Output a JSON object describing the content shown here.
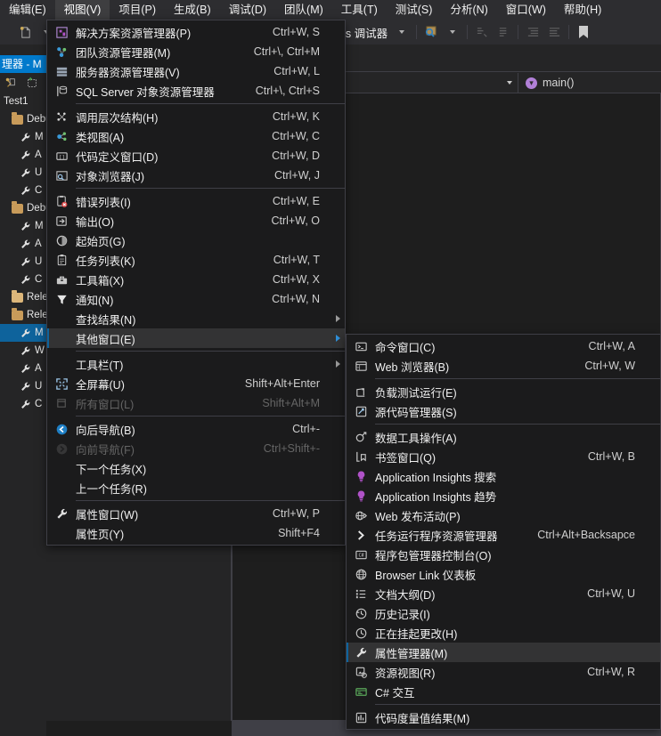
{
  "app": {
    "title": "Visual Studio",
    "accent": "#007acc",
    "menu_bg": "#1b1b1c",
    "highlight": "#333334"
  },
  "menubar": {
    "items": [
      {
        "label": "编辑(E)",
        "active": false
      },
      {
        "label": "视图(V)",
        "active": true
      },
      {
        "label": "项目(P)",
        "active": false
      },
      {
        "label": "生成(B)",
        "active": false
      },
      {
        "label": "调试(D)",
        "active": false
      },
      {
        "label": "团队(M)",
        "active": false
      },
      {
        "label": "工具(T)",
        "active": false
      },
      {
        "label": "测试(S)",
        "active": false
      },
      {
        "label": "分析(N)",
        "active": false
      },
      {
        "label": "窗口(W)",
        "active": false
      },
      {
        "label": "帮助(H)",
        "active": false
      }
    ]
  },
  "toolbar": {
    "run_label": "本地 Windows 调试器",
    "run_icon": "play-icon",
    "icons": [
      "new-item-icon",
      "find-icon",
      "comment-icon",
      "uncomment-icon",
      "indent-icon",
      "outdent-icon",
      "bookmark-icon"
    ]
  },
  "solution_explorer": {
    "title": "理器 - M",
    "full_title": "解决方案资源管理器 - Main",
    "toolbar_icons": [
      "refresh-icon",
      "show-all-files-icon"
    ],
    "tree": [
      {
        "label": "Test1",
        "icon": "project-icon",
        "depth": 0,
        "selected": false
      },
      {
        "label": "Debu",
        "icon": "folder-open-icon",
        "depth": 1,
        "selected": false
      },
      {
        "label": "M",
        "icon": "wrench-icon",
        "depth": 2,
        "selected": false
      },
      {
        "label": "A",
        "icon": "wrench-icon",
        "depth": 2,
        "selected": false
      },
      {
        "label": "U",
        "icon": "wrench-icon",
        "depth": 2,
        "selected": false
      },
      {
        "label": "C",
        "icon": "wrench-icon",
        "depth": 2,
        "selected": false
      },
      {
        "label": "Debu",
        "icon": "folder-open-icon",
        "depth": 1,
        "selected": false
      },
      {
        "label": "M",
        "icon": "wrench-icon",
        "depth": 2,
        "selected": false
      },
      {
        "label": "A",
        "icon": "wrench-icon",
        "depth": 2,
        "selected": false
      },
      {
        "label": "U",
        "icon": "wrench-icon",
        "depth": 2,
        "selected": false
      },
      {
        "label": "C",
        "icon": "wrench-icon",
        "depth": 2,
        "selected": false
      },
      {
        "label": "Relea",
        "icon": "folder-icon",
        "depth": 1,
        "selected": false
      },
      {
        "label": "Relea",
        "icon": "folder-open-icon",
        "depth": 1,
        "selected": false
      },
      {
        "label": "M",
        "icon": "wrench-icon",
        "depth": 2,
        "selected": true
      },
      {
        "label": "W",
        "icon": "wrench-icon",
        "depth": 2,
        "selected": false
      },
      {
        "label": "A",
        "icon": "wrench-icon",
        "depth": 2,
        "selected": false
      },
      {
        "label": "U",
        "icon": "wrench-icon",
        "depth": 2,
        "selected": false
      },
      {
        "label": "C",
        "icon": "wrench-icon",
        "depth": 2,
        "selected": false
      }
    ]
  },
  "navbar": {
    "member": "main()",
    "member_icon": "method-icon"
  },
  "view_menu": {
    "items": [
      {
        "type": "item",
        "icon": "solution-explorer-icon",
        "label": "解决方案资源管理器(P)",
        "shortcut": "Ctrl+W, S",
        "disabled": false,
        "submenu": false,
        "highlight": false
      },
      {
        "type": "item",
        "icon": "team-explorer-icon",
        "label": "团队资源管理器(M)",
        "shortcut": "Ctrl+\\, Ctrl+M",
        "disabled": false,
        "submenu": false,
        "highlight": false
      },
      {
        "type": "item",
        "icon": "server-explorer-icon",
        "label": "服务器资源管理器(V)",
        "shortcut": "Ctrl+W, L",
        "disabled": false,
        "submenu": false,
        "highlight": false
      },
      {
        "type": "item",
        "icon": "sql-object-explorer-icon",
        "label": "SQL Server 对象资源管理器",
        "shortcut": "Ctrl+\\, Ctrl+S",
        "disabled": false,
        "submenu": false,
        "highlight": false
      },
      {
        "type": "sep"
      },
      {
        "type": "item",
        "icon": "call-hierarchy-icon",
        "label": "调用层次结构(H)",
        "shortcut": "Ctrl+W, K",
        "disabled": false,
        "submenu": false,
        "highlight": false
      },
      {
        "type": "item",
        "icon": "class-view-icon",
        "label": "类视图(A)",
        "shortcut": "Ctrl+W, C",
        "disabled": false,
        "submenu": false,
        "highlight": false
      },
      {
        "type": "item",
        "icon": "code-definition-icon",
        "label": "代码定义窗口(D)",
        "shortcut": "Ctrl+W, D",
        "disabled": false,
        "submenu": false,
        "highlight": false
      },
      {
        "type": "item",
        "icon": "object-browser-icon",
        "label": "对象浏览器(J)",
        "shortcut": "Ctrl+W, J",
        "disabled": false,
        "submenu": false,
        "highlight": false
      },
      {
        "type": "sep"
      },
      {
        "type": "item",
        "icon": "error-list-icon",
        "label": "错误列表(I)",
        "shortcut": "Ctrl+W, E",
        "disabled": false,
        "submenu": false,
        "highlight": false
      },
      {
        "type": "item",
        "icon": "output-icon",
        "label": "输出(O)",
        "shortcut": "Ctrl+W, O",
        "disabled": false,
        "submenu": false,
        "highlight": false
      },
      {
        "type": "item",
        "icon": "start-page-icon",
        "label": "起始页(G)",
        "shortcut": "",
        "disabled": false,
        "submenu": false,
        "highlight": false
      },
      {
        "type": "item",
        "icon": "task-list-icon",
        "label": "任务列表(K)",
        "shortcut": "Ctrl+W, T",
        "disabled": false,
        "submenu": false,
        "highlight": false
      },
      {
        "type": "item",
        "icon": "toolbox-icon",
        "label": "工具箱(X)",
        "shortcut": "Ctrl+W, X",
        "disabled": false,
        "submenu": false,
        "highlight": false
      },
      {
        "type": "item",
        "icon": "notification-icon",
        "label": "通知(N)",
        "shortcut": "Ctrl+W, N",
        "disabled": false,
        "submenu": false,
        "highlight": false
      },
      {
        "type": "item",
        "icon": "",
        "label": "查找结果(N)",
        "shortcut": "",
        "disabled": false,
        "submenu": true,
        "highlight": false
      },
      {
        "type": "item",
        "icon": "",
        "label": "其他窗口(E)",
        "shortcut": "",
        "disabled": false,
        "submenu": true,
        "highlight": true
      },
      {
        "type": "sep"
      },
      {
        "type": "item",
        "icon": "",
        "label": "工具栏(T)",
        "shortcut": "",
        "disabled": false,
        "submenu": true,
        "highlight": false
      },
      {
        "type": "item",
        "icon": "fullscreen-icon",
        "label": "全屏幕(U)",
        "shortcut": "Shift+Alt+Enter",
        "disabled": false,
        "submenu": false,
        "highlight": false
      },
      {
        "type": "item",
        "icon": "all-windows-icon",
        "label": "所有窗口(L)",
        "shortcut": "Shift+Alt+M",
        "disabled": true,
        "submenu": false,
        "highlight": false
      },
      {
        "type": "sep"
      },
      {
        "type": "item",
        "icon": "navigate-backward-icon",
        "label": "向后导航(B)",
        "shortcut": "Ctrl+-",
        "disabled": false,
        "submenu": false,
        "highlight": false
      },
      {
        "type": "item",
        "icon": "navigate-forward-icon",
        "label": "向前导航(F)",
        "shortcut": "Ctrl+Shift+-",
        "disabled": true,
        "submenu": false,
        "highlight": false
      },
      {
        "type": "item",
        "icon": "",
        "label": "下一个任务(X)",
        "shortcut": "",
        "disabled": false,
        "submenu": false,
        "highlight": false
      },
      {
        "type": "item",
        "icon": "",
        "label": "上一个任务(R)",
        "shortcut": "",
        "disabled": false,
        "submenu": false,
        "highlight": false
      },
      {
        "type": "sep"
      },
      {
        "type": "item",
        "icon": "wrench-icon",
        "label": "属性窗口(W)",
        "shortcut": "Ctrl+W, P",
        "disabled": false,
        "submenu": false,
        "highlight": false
      },
      {
        "type": "item",
        "icon": "",
        "label": "属性页(Y)",
        "shortcut": "Shift+F4",
        "disabled": false,
        "submenu": false,
        "highlight": false
      }
    ]
  },
  "other_windows_menu": {
    "items": [
      {
        "type": "item",
        "icon": "command-window-icon",
        "label": "命令窗口(C)",
        "shortcut": "Ctrl+W, A",
        "disabled": false,
        "highlight": false
      },
      {
        "type": "item",
        "icon": "web-browser-icon",
        "label": "Web 浏览器(B)",
        "shortcut": "Ctrl+W, W",
        "disabled": false,
        "highlight": false
      },
      {
        "type": "sep"
      },
      {
        "type": "item",
        "icon": "load-test-icon",
        "label": "负载测试运行(E)",
        "shortcut": "",
        "disabled": false,
        "highlight": false
      },
      {
        "type": "item",
        "icon": "source-control-icon",
        "label": "源代码管理器(S)",
        "shortcut": "",
        "disabled": false,
        "highlight": false
      },
      {
        "type": "sep"
      },
      {
        "type": "item",
        "icon": "data-tools-icon",
        "label": "数据工具操作(A)",
        "shortcut": "",
        "disabled": false,
        "highlight": false
      },
      {
        "type": "item",
        "icon": "bookmark-window-icon",
        "label": "书签窗口(Q)",
        "shortcut": "Ctrl+W, B",
        "disabled": false,
        "highlight": false
      },
      {
        "type": "item",
        "icon": "app-insights-search-icon",
        "label": "Application Insights 搜索",
        "shortcut": "",
        "disabled": false,
        "highlight": false
      },
      {
        "type": "item",
        "icon": "app-insights-trend-icon",
        "label": "Application Insights 趋势",
        "shortcut": "",
        "disabled": false,
        "highlight": false
      },
      {
        "type": "item",
        "icon": "web-publish-icon",
        "label": "Web 发布活动(P)",
        "shortcut": "",
        "disabled": false,
        "highlight": false
      },
      {
        "type": "item",
        "icon": "task-runner-icon",
        "label": "任务运行程序资源管理器",
        "shortcut": "Ctrl+Alt+Backsapce",
        "disabled": false,
        "highlight": false
      },
      {
        "type": "item",
        "icon": "package-manager-icon",
        "label": "程序包管理器控制台(O)",
        "shortcut": "",
        "disabled": false,
        "highlight": false
      },
      {
        "type": "item",
        "icon": "browser-link-icon",
        "label": "Browser Link 仪表板",
        "shortcut": "",
        "disabled": false,
        "highlight": false
      },
      {
        "type": "item",
        "icon": "document-outline-icon",
        "label": "文档大纲(D)",
        "shortcut": "Ctrl+W, U",
        "disabled": false,
        "highlight": false
      },
      {
        "type": "item",
        "icon": "history-icon",
        "label": "历史记录(I)",
        "shortcut": "",
        "disabled": false,
        "highlight": false
      },
      {
        "type": "item",
        "icon": "pending-changes-icon",
        "label": "正在挂起更改(H)",
        "shortcut": "",
        "disabled": false,
        "highlight": false
      },
      {
        "type": "item",
        "icon": "wrench-icon",
        "label": "属性管理器(M)",
        "shortcut": "",
        "disabled": false,
        "highlight": true
      },
      {
        "type": "item",
        "icon": "resource-view-icon",
        "label": "资源视图(R)",
        "shortcut": "Ctrl+W, R",
        "disabled": false,
        "highlight": false
      },
      {
        "type": "item",
        "icon": "csharp-interactive-icon",
        "label": "C# 交互",
        "shortcut": "",
        "disabled": false,
        "highlight": false
      },
      {
        "type": "sep"
      },
      {
        "type": "item",
        "icon": "code-metrics-icon",
        "label": "代码度量值结果(M)",
        "shortcut": "",
        "disabled": false,
        "highlight": false
      }
    ]
  }
}
